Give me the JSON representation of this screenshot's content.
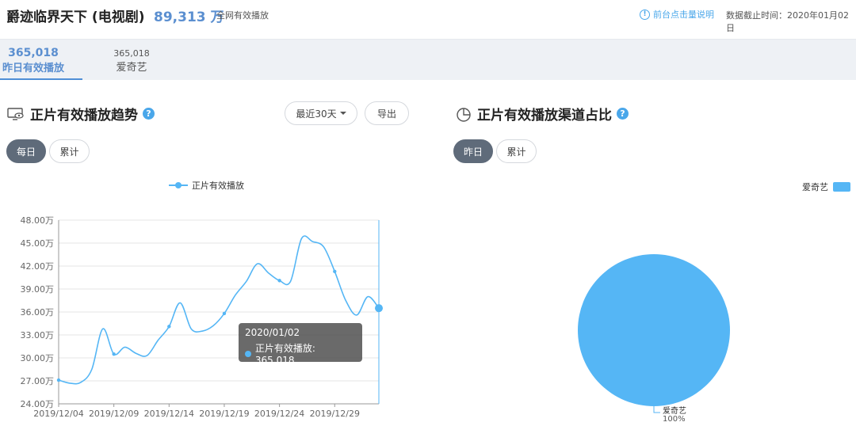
{
  "header": {
    "title": "爵迹临界天下 (电视剧)",
    "total": "89,313 万",
    "total_label": "全网有效播放",
    "help_link": "前台点击量说明",
    "deadline": "数据截止时间：2020年01月02日"
  },
  "platform_tabs": [
    {
      "number": "365,018",
      "label": "昨日有效播放",
      "active": true
    },
    {
      "number": "365,018",
      "label": "爱奇艺",
      "active": false
    }
  ],
  "trend": {
    "title": "正片有效播放趋势",
    "range_select": "最近30天",
    "export_label": "导出",
    "toggle_daily": "每日",
    "toggle_cumulative": "累计",
    "legend": "正片有效播放",
    "tooltip_date": "2020/01/02",
    "tooltip_label": "正片有效播放: 365,018"
  },
  "share": {
    "title": "正片有效播放渠道占比",
    "toggle_yesterday": "昨日",
    "toggle_cumulative": "累计",
    "legend": "爱奇艺",
    "slice_label": "爱奇艺",
    "slice_percent": "100%"
  },
  "colors": {
    "series": "#55b6f5",
    "accent": "#5b8fd0",
    "dark_toggle": "#5f6b7a"
  },
  "chart_data": [
    {
      "type": "line",
      "legend": [
        "正片有效播放"
      ],
      "y_tick_labels": [
        "24.00万",
        "27.00万",
        "30.00万",
        "33.00万",
        "36.00万",
        "39.00万",
        "42.00万",
        "45.00万",
        "48.00万"
      ],
      "ylim": [
        24,
        48
      ],
      "y_unit": "万",
      "x_tick_labels": [
        "2019/12/04",
        "2019/12/09",
        "2019/12/14",
        "2019/12/19",
        "2019/12/24",
        "2019/12/29"
      ],
      "x": [
        "2019/12/04",
        "2019/12/05",
        "2019/12/06",
        "2019/12/07",
        "2019/12/08",
        "2019/12/09",
        "2019/12/10",
        "2019/12/11",
        "2019/12/12",
        "2019/12/13",
        "2019/12/14",
        "2019/12/15",
        "2019/12/16",
        "2019/12/17",
        "2019/12/18",
        "2019/12/19",
        "2019/12/20",
        "2019/12/21",
        "2019/12/22",
        "2019/12/23",
        "2019/12/24",
        "2019/12/25",
        "2019/12/26",
        "2019/12/27",
        "2019/12/28",
        "2019/12/29",
        "2019/12/30",
        "2019/12/31",
        "2020/01/01",
        "2020/01/02"
      ],
      "series": [
        {
          "name": "正片有效播放",
          "values": [
            27.1,
            26.7,
            26.8,
            28.5,
            33.8,
            30.5,
            31.4,
            30.6,
            30.3,
            32.3,
            34.1,
            37.2,
            33.8,
            33.5,
            34.2,
            35.8,
            38.2,
            40.0,
            42.3,
            41.1,
            40.1,
            40.0,
            45.6,
            45.2,
            44.5,
            41.3,
            37.5,
            35.6,
            38.0,
            36.5
          ]
        }
      ],
      "grid": true
    },
    {
      "type": "pie",
      "legend": [
        "爱奇艺"
      ],
      "categories": [
        "爱奇艺"
      ],
      "values": [
        100
      ]
    }
  ]
}
